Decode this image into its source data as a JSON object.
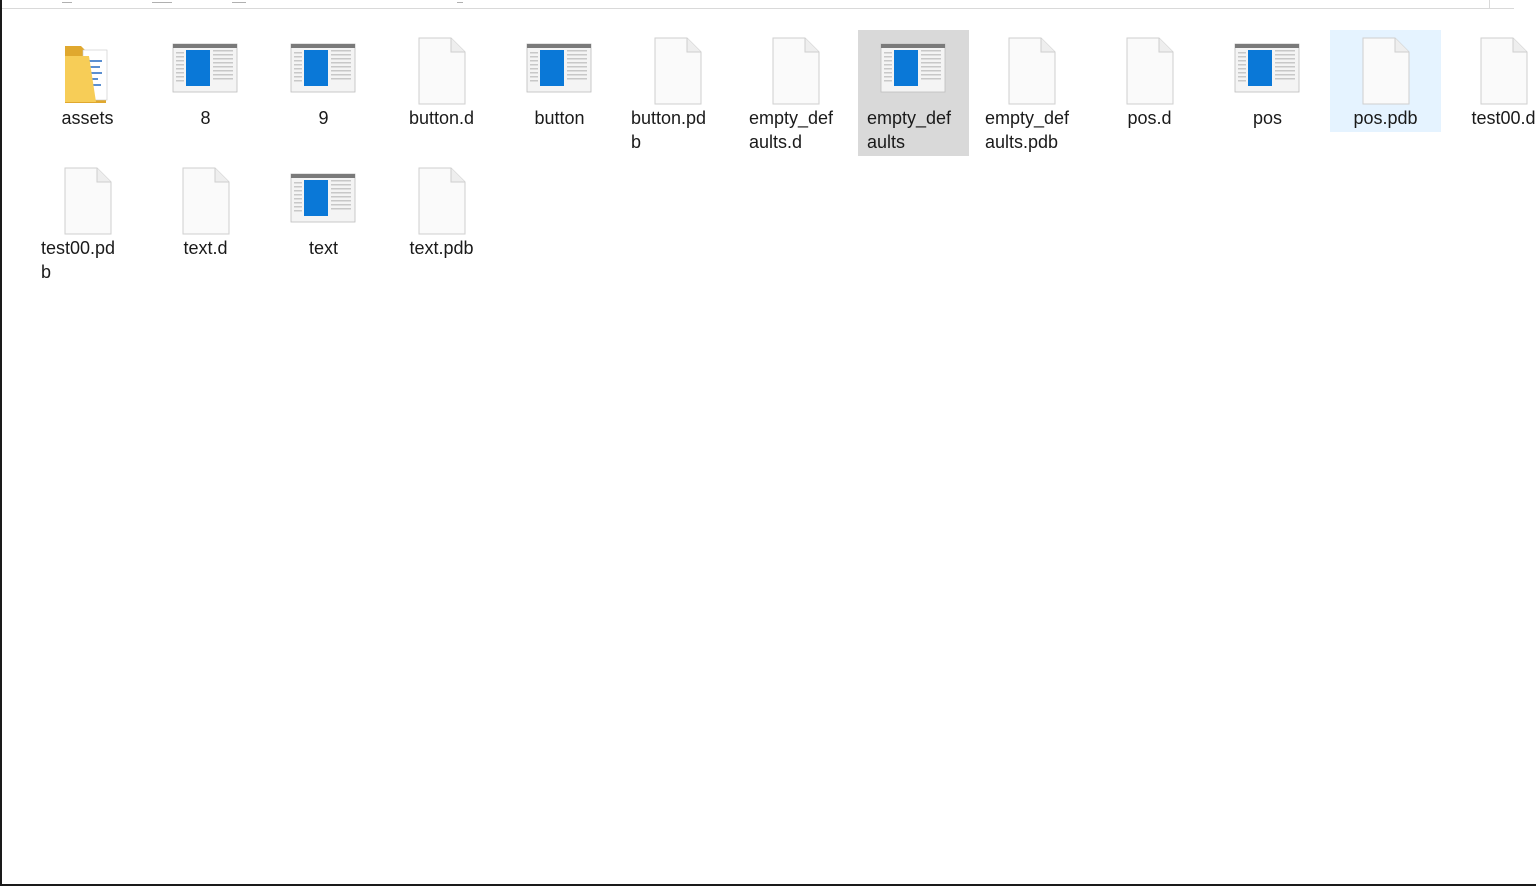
{
  "explorer": {
    "items": [
      {
        "name": "assets",
        "icon": "folder-icon",
        "state": "normal"
      },
      {
        "name": "8",
        "icon": "app-window-icon",
        "state": "normal"
      },
      {
        "name": "9",
        "icon": "app-window-icon",
        "state": "normal"
      },
      {
        "name": "button.d",
        "icon": "blank-file-icon",
        "state": "normal"
      },
      {
        "name": "button",
        "icon": "app-window-icon",
        "state": "normal"
      },
      {
        "name": "button.pdb",
        "icon": "blank-file-icon",
        "state": "normal"
      },
      {
        "name": "empty_defaults.d",
        "icon": "blank-file-icon",
        "state": "normal"
      },
      {
        "name": "empty_defaults",
        "icon": "app-window-icon",
        "state": "selected"
      },
      {
        "name": "empty_defaults.pdb",
        "icon": "blank-file-icon",
        "state": "normal"
      },
      {
        "name": "pos.d",
        "icon": "blank-file-icon",
        "state": "normal"
      },
      {
        "name": "pos",
        "icon": "app-window-icon",
        "state": "normal"
      },
      {
        "name": "pos.pdb",
        "icon": "blank-file-icon",
        "state": "hover"
      },
      {
        "name": "test00.d",
        "icon": "blank-file-icon",
        "state": "normal"
      },
      {
        "name": "test00.pdb",
        "icon": "blank-file-icon",
        "state": "normal"
      },
      {
        "name": "text.d",
        "icon": "blank-file-icon",
        "state": "normal"
      },
      {
        "name": "text",
        "icon": "app-window-icon",
        "state": "normal"
      },
      {
        "name": "text.pdb",
        "icon": "blank-file-icon",
        "state": "normal"
      }
    ],
    "labels_display": [
      "assets",
      "8",
      "9",
      "button.d",
      "button",
      "button.pd\nb",
      "empty_def\naults.d",
      "empty_def\naults",
      "empty_def\naults.pdb",
      "pos.d",
      "pos",
      "pos.pdb",
      "test00.d",
      "test00.pd\nb",
      "text.d",
      "text",
      "text.pdb"
    ],
    "colors": {
      "selected_bg": "#d9d9d9",
      "hover_bg": "#e5f3ff",
      "folder": "#f5c542",
      "app_blue": "#0a78d7"
    }
  }
}
